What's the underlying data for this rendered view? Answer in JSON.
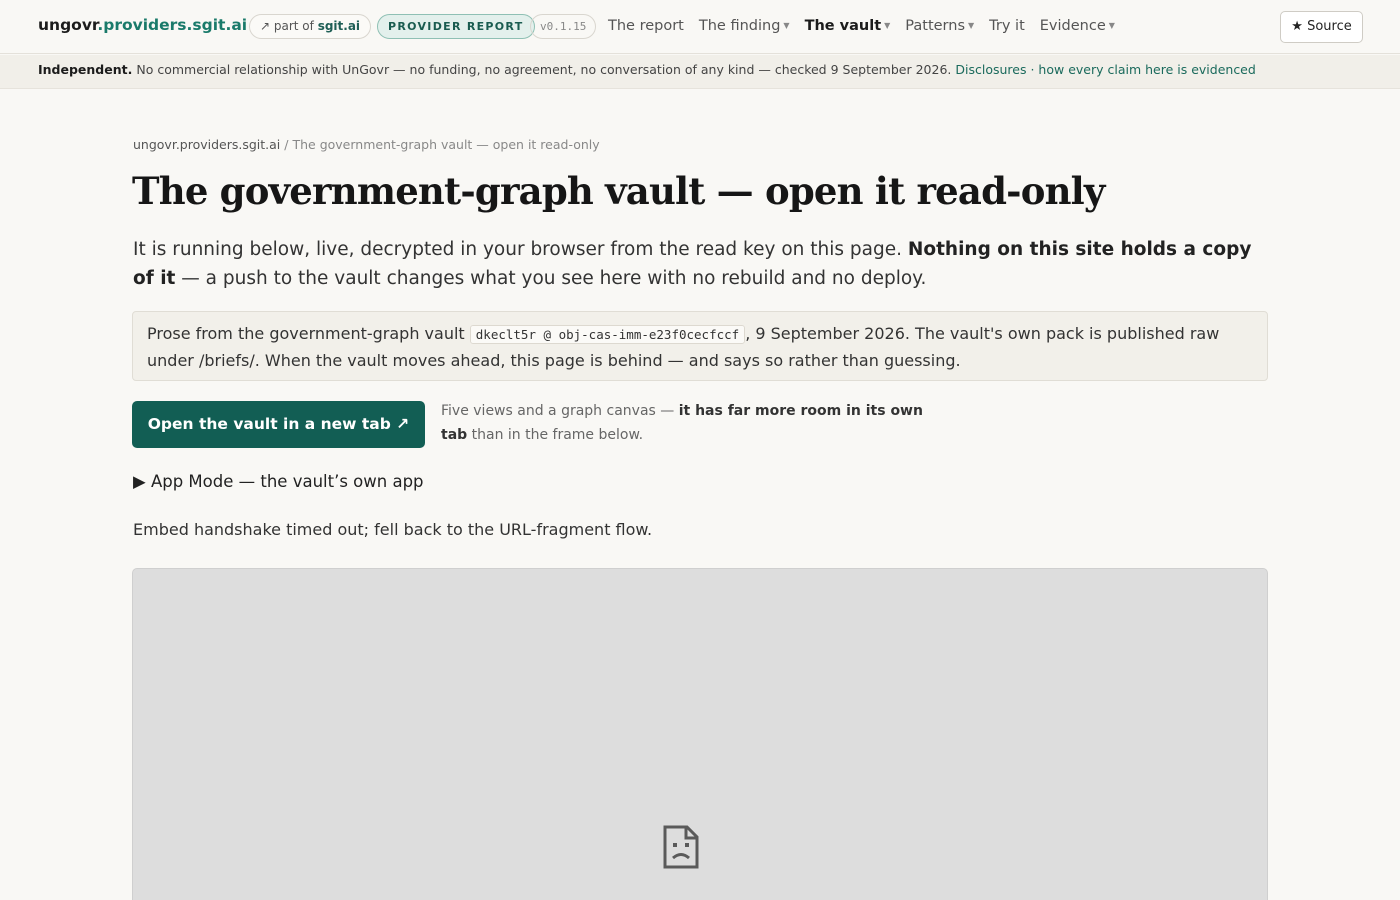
{
  "header": {
    "brand_prefix": "ungovr",
    "brand_suffix": ".providers.sgit.ai",
    "part_of_prefix": "↗ part of",
    "part_of_link": "sgit.ai",
    "badge": "PROVIDER REPORT",
    "version": "v0.1.15",
    "nav": {
      "report": "The report",
      "finding": "The finding",
      "vault": "The vault",
      "patterns": "Patterns",
      "try_it": "Try it",
      "evidence": "Evidence"
    },
    "source_button": "★ Source"
  },
  "notice": {
    "strong": "Independent.",
    "text": "No commercial relationship with UnGovr — no funding, no agreement, no conversation of any kind — checked 9 September 2026.",
    "link_disclosures": "Disclosures",
    "separator": "·",
    "link_evidence": "how every claim here is evidenced"
  },
  "breadcrumb": {
    "home": "ungovr.providers.sgit.ai",
    "separator": "/",
    "current": "The government-graph vault — open it read-only"
  },
  "page": {
    "title": "The government-graph vault — open it read-only",
    "lead_plain": "It is running below, live, decrypted in your browser from the read key on this page.",
    "lead_bold": "Nothing on this site holds a copy of it",
    "lead_rest": "— a push to the vault changes what you see here with no rebuild and no deploy."
  },
  "callout": {
    "prefix": "Prose from the government-graph vault",
    "code": "dkeclt5r @ obj-cas-imm-e23f0cecfccf",
    "suffix": ", 9 September 2026. The vault's own pack is published raw under /briefs/. When the vault moves ahead, this page is behind — and says so rather than guessing."
  },
  "actions": {
    "open_button": "Open the vault in a new tab ↗",
    "note_plain": "Five views and a graph canvas —",
    "note_bold": "it has far more room in its own tab",
    "note_rest": "than in the frame below."
  },
  "app_mode": {
    "marker": "▶",
    "label": "App Mode — the vault’s own app"
  },
  "status": {
    "fallback": "Embed handshake timed out; fell back to the URL-fragment flow."
  },
  "embed": {
    "icon": "sad-page-icon"
  }
}
